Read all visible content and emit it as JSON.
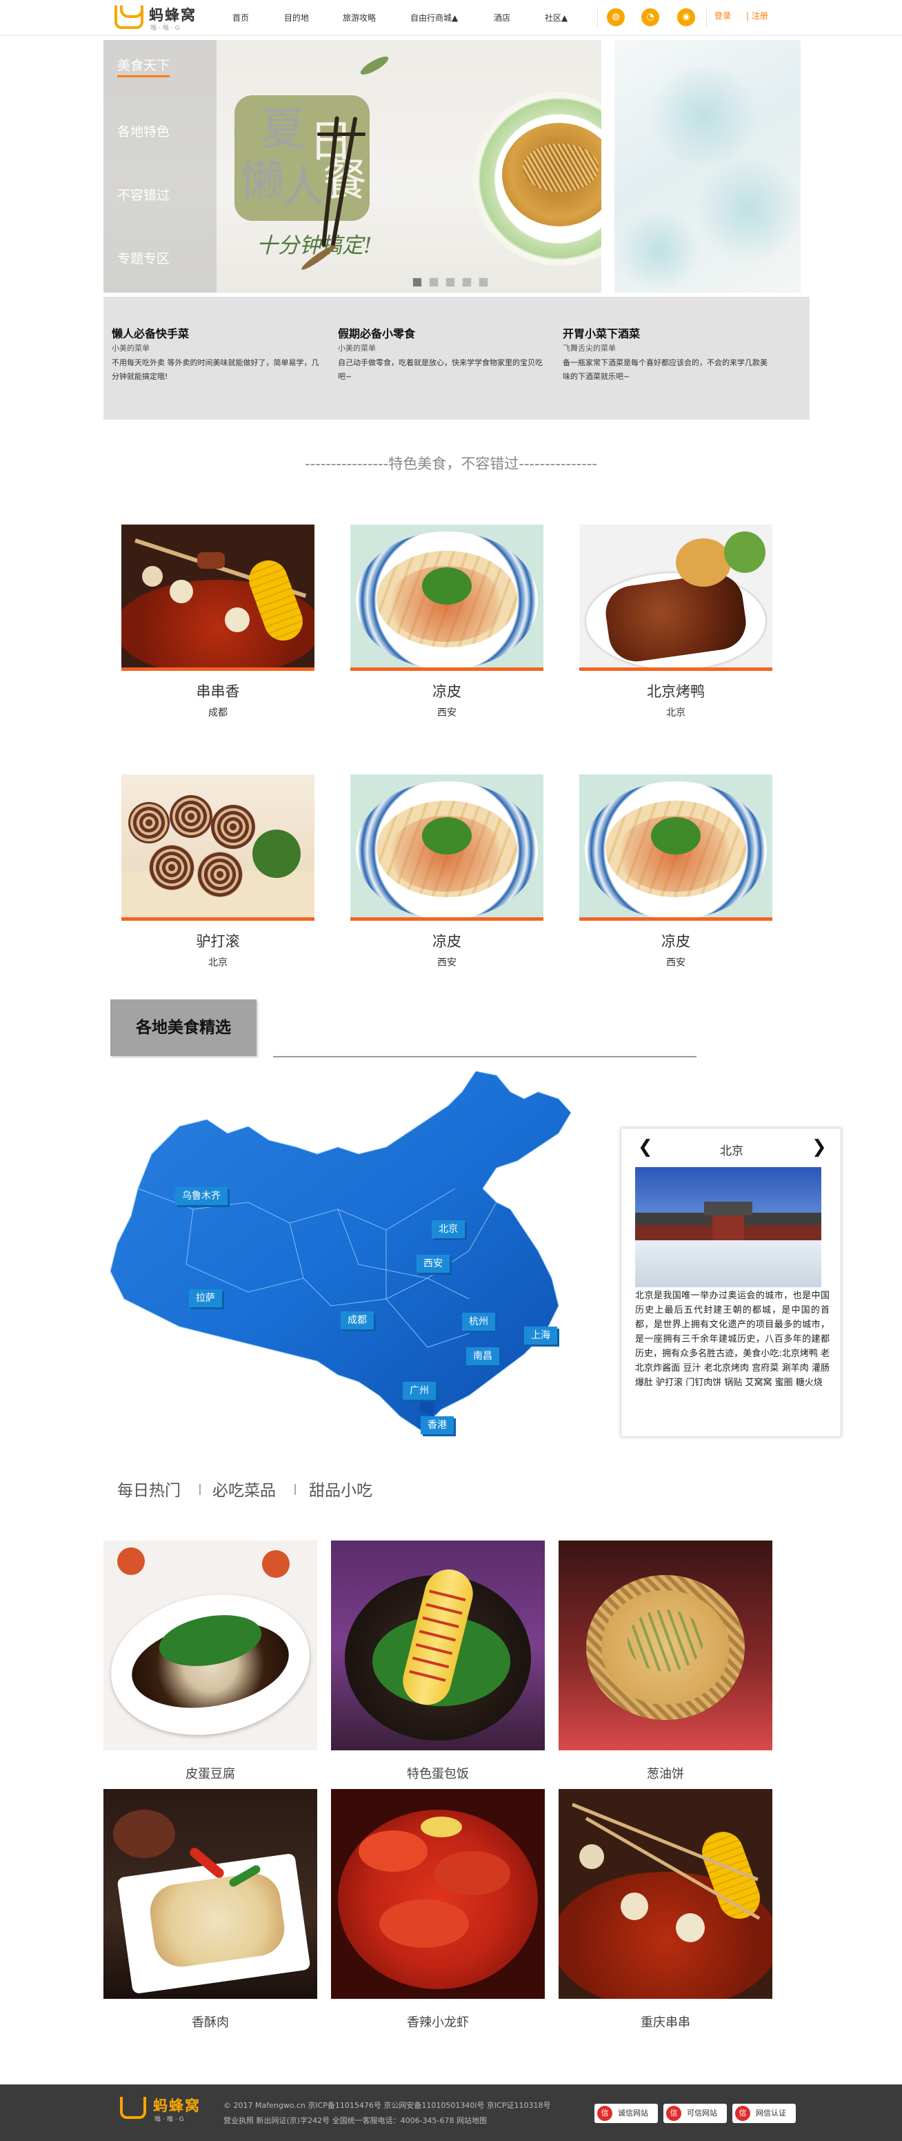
{
  "header": {
    "logo_title": "蚂蜂窝",
    "logo_sub": "嗡·嗡·G",
    "nav": [
      "首页",
      "目的地",
      "旅游攻略",
      "自由行商城▲",
      "酒店",
      "社区▲"
    ],
    "icons": [
      "wechat-icon",
      "qq-icon",
      "weibo-icon"
    ],
    "icon_glyphs": [
      "◍",
      "◔",
      "◉"
    ],
    "login": "登录",
    "register": "| 注册"
  },
  "hero": {
    "menu": [
      "美食天下",
      "各地特色",
      "不容错过",
      "专题专区"
    ],
    "poster_chars": [
      "夏",
      "日",
      "懒",
      "人",
      "餐"
    ],
    "poster_slogan": "十分钟搞定!",
    "dots": 5,
    "active_dot": 0
  },
  "hero_cards": [
    {
      "title": "懒人必备快手菜",
      "sub": "小美的菜单",
      "desc": "不用每天吃外卖 等外卖的时间美味就能做好了，简单易学，几分钟就能搞定哦!"
    },
    {
      "title": "假期必备小零食",
      "sub": "小美的菜单",
      "desc": "自己动手做零食，吃着就是放心，快来学学食物家里的宝贝吃吧~"
    },
    {
      "title": "开胃小菜下酒菜",
      "sub": "飞舞舌尖的菜单",
      "desc": "备一瓶家常下酒菜是每个喜好都应该会的，不会的来学几款美味的下酒菜就乐吧~"
    }
  ],
  "section_title": "----------------特色美食，不容错过---------------",
  "featured": [
    {
      "name": "串串香",
      "city": "成都"
    },
    {
      "name": "凉皮",
      "city": "西安"
    },
    {
      "name": "北京烤鸭",
      "city": "北京"
    },
    {
      "name": "驴打滚",
      "city": "北京"
    },
    {
      "name": "凉皮",
      "city": "西安"
    },
    {
      "name": "凉皮",
      "city": "西安"
    }
  ],
  "region": {
    "tab": "各地美食精选",
    "cities": [
      "乌鲁木齐",
      "拉萨",
      "北京",
      "西安",
      "成都",
      "杭州",
      "上海",
      "南昌",
      "广州",
      "香港"
    ]
  },
  "city_card": {
    "prev": "❮",
    "next": "❯",
    "name": "北京",
    "text": "北京是我国唯一举办过奥运会的城市，也是中国历史上最后五代封建王朝的都城，是中国的首都，是世界上拥有文化遗产的项目最多的城市，是一座拥有三千余年建城历史，八百多年的建都历史，拥有众多名胜古迹，美食小吃:北京烤鸭 老北京炸酱面 豆汁 老北京烤肉 宫府菜 涮羊肉 灌肠 爆肚 驴打滚 门钉肉饼 锅贴 艾窝窝 蜜圈 糖火烧"
  },
  "tabs": [
    "每日热门",
    "必吃菜品",
    "甜品小吃"
  ],
  "dishes": [
    "皮蛋豆腐",
    "特色蛋包饭",
    "葱油饼",
    "香酥肉",
    "香辣小龙虾",
    "重庆串串"
  ],
  "footer": {
    "logo_title": "蚂蜂窝",
    "logo_sub": "嗡·嗡·G",
    "line1": "© 2017 Mafengwo.cn 京ICP备11015476号 京公网安备11010501340l号 京ICP证110318号",
    "line2": "营业执照 新出网证(京)字242号 全国统一客服电话：4006-345-678  网站地图",
    "badges": [
      "诚信网站",
      "可信网站",
      "网信认证"
    ]
  },
  "colors": {
    "accent": "#ff7b00",
    "orange_bar": "#f26522",
    "map_blue": "#1b8bd9",
    "footer_bg": "#3b3b3b"
  }
}
